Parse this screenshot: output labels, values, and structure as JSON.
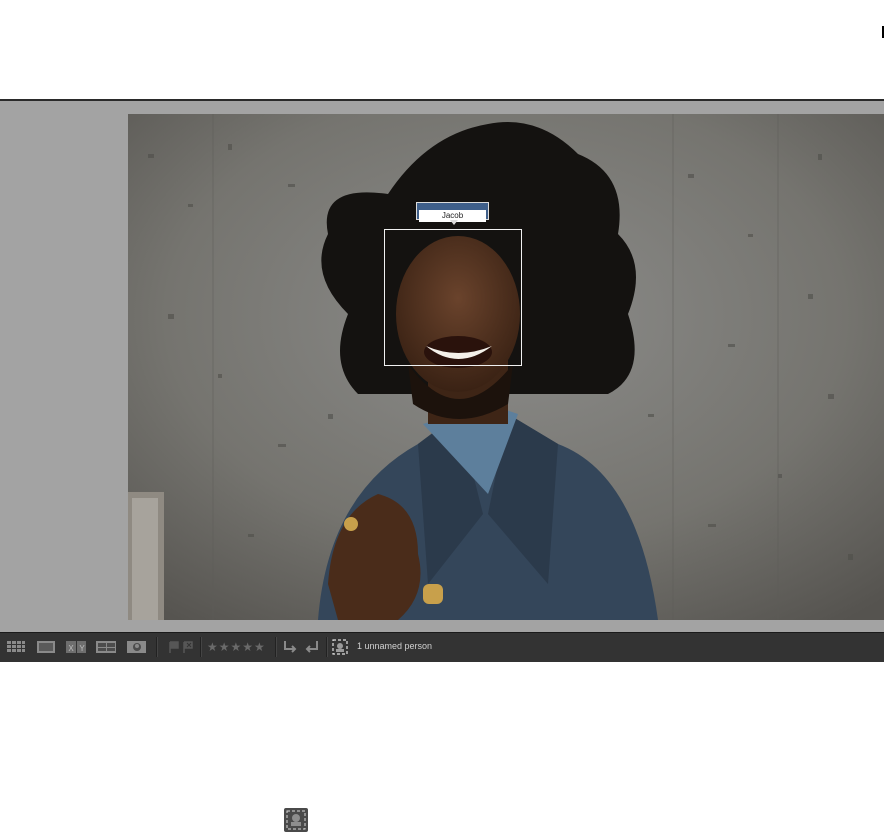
{
  "loupe": {
    "face_tag": {
      "name": "Jacob"
    }
  },
  "toolbar": {
    "view_buttons": [
      {
        "icon": "grid-view-icon"
      },
      {
        "icon": "loupe-view-icon"
      },
      {
        "icon": "compare-view-icon",
        "text": "XY"
      },
      {
        "icon": "survey-view-icon"
      },
      {
        "icon": "people-view-icon"
      }
    ],
    "flags": [
      "flag-pick-icon",
      "flag-reject-icon"
    ],
    "rating_stars": "★★★★★",
    "rotate": [
      "rotate-left-icon",
      "rotate-right-icon"
    ],
    "face_region_tool": "face-region-icon",
    "people_status": "1 unnamed person"
  },
  "colors": {
    "face_tag_bg": "#3f5f8a",
    "toolbar_bg": "#333333",
    "window_bg": "#a3a3a3"
  }
}
